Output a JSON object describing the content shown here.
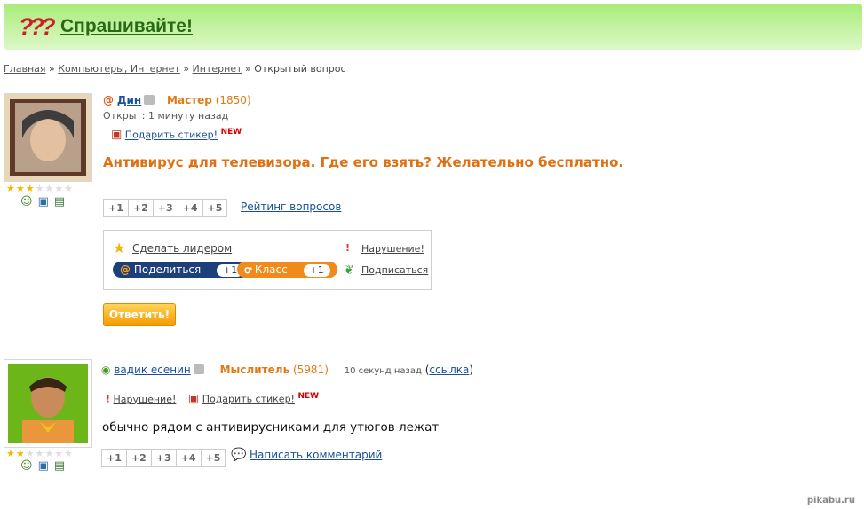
{
  "header": {
    "logo": "???",
    "title": "Спрашивайте!"
  },
  "breadcrumb": {
    "home": "Главная",
    "cat1": "Компьютеры, Интернет",
    "cat2": "Интернет",
    "sep": "»",
    "current": "Открытый вопрос"
  },
  "question": {
    "author": "Дин",
    "rank": "Мастер",
    "rank_points": "(1850)",
    "opened": "Открыт: 1 минуту назад",
    "gift": "Подарить стикер!",
    "new_badge": "NEW",
    "text": "Антивирус для телевизора. Где его взять? Желательно бесплатно.",
    "votes": [
      "+1",
      "+2",
      "+3",
      "+4",
      "+5"
    ],
    "rating_link": "Рейтинг вопросов",
    "make_leader": "Сделать лидером",
    "violation": "Нарушение!",
    "share": "Поделиться",
    "share_count": "+1",
    "klass": "Класс",
    "klass_count": "+1",
    "subscribe": "Подписаться",
    "answer_button": "Ответить!",
    "stars": 3
  },
  "answer": {
    "author": "вадик есенин",
    "rank": "Мыслитель",
    "rank_points": "(5981)",
    "time": "10 секунд назад",
    "link_open": "(",
    "link": "ссылка",
    "link_close": ")",
    "violation": "Нарушение!",
    "gift": "Подарить стикер!",
    "new_badge": "NEW",
    "text": "обычно рядом с антивирусниками для утюгов лежат",
    "votes": [
      "+1",
      "+2",
      "+3",
      "+4",
      "+5"
    ],
    "comment_link": "Написать комментарий",
    "stars": 2
  },
  "watermark": "pikabu.ru",
  "colors": {
    "accent_orange": "#e07012",
    "header_green": "#a8ec78",
    "link": "#1a4f9c"
  }
}
